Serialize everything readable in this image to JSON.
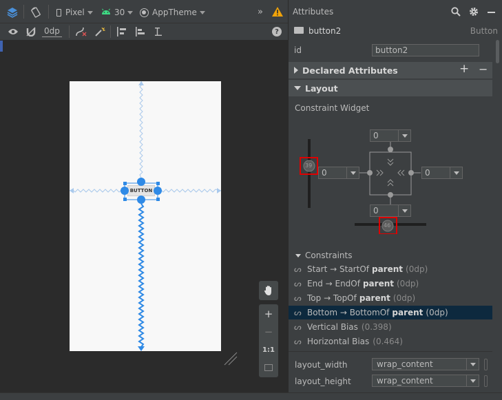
{
  "toolbar": {
    "device": "Pixel",
    "api_level": "30",
    "theme": "AppTheme",
    "default_margin": "0dp",
    "overflow": "»"
  },
  "canvas": {
    "button_label": "BUTTON"
  },
  "zoom": {
    "zoom_in": "+",
    "zoom_out": "−",
    "actual_size": "1:1"
  },
  "attributes": {
    "panel_title": "Attributes",
    "component_name": "button2",
    "component_type": "Button",
    "id_label": "id",
    "id_value": "button2",
    "declared_section": "Declared Attributes",
    "add_symbol": "+",
    "remove_symbol": "−",
    "layout_section": "Layout",
    "constraint_widget_label": "Constraint Widget",
    "widget": {
      "top_margin": "0",
      "left_margin": "0",
      "right_margin": "0",
      "bottom_margin": "0",
      "vertical_bias": "39",
      "horizontal_bias": "46"
    },
    "constraints_section": "Constraints",
    "constraints": [
      {
        "pre": "Start → StartOf",
        "target": "parent",
        "post": "(0dp)"
      },
      {
        "pre": "End → EndOf",
        "target": "parent",
        "post": "(0dp)"
      },
      {
        "pre": "Top → TopOf",
        "target": "parent",
        "post": "(0dp)"
      },
      {
        "pre": "Bottom → BottomOf",
        "target": "parent",
        "post": "(0dp)"
      },
      {
        "pre": "Vertical Bias",
        "target": "",
        "post": "(0.398)"
      },
      {
        "pre": "Horizontal Bias",
        "target": "",
        "post": "(0.464)"
      }
    ],
    "layout_width_label": "layout_width",
    "layout_width_value": "wrap_content",
    "layout_height_label": "layout_height",
    "layout_height_value": "wrap_content"
  },
  "colors": {
    "accent_blue": "#2f8ae6",
    "highlight_red": "#e00000",
    "selection": "#0d293e",
    "warning": "#f0a30a"
  }
}
